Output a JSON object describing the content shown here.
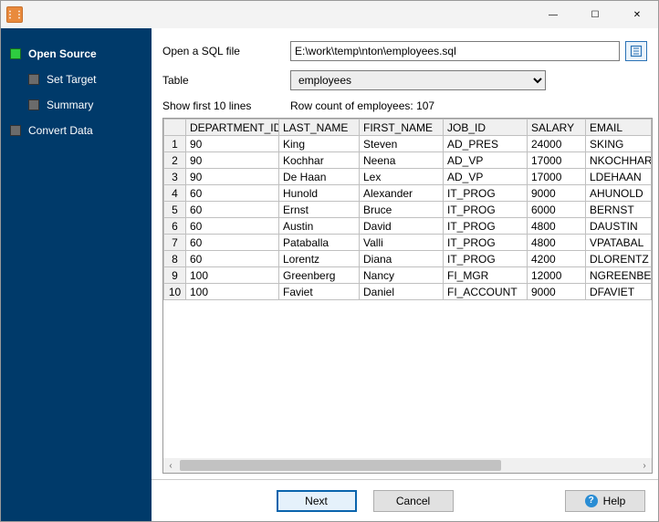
{
  "window": {
    "min_symbol": "—",
    "max_symbol": "☐",
    "close_symbol": "✕"
  },
  "sidebar": {
    "steps": [
      {
        "label": "Open Source",
        "current": true,
        "child": false
      },
      {
        "label": "Set Target",
        "current": false,
        "child": true
      },
      {
        "label": "Summary",
        "current": false,
        "child": true
      },
      {
        "label": "Convert Data",
        "current": false,
        "child": false
      }
    ]
  },
  "form": {
    "file_label": "Open a SQL file",
    "file_value": "E:\\work\\temp\\nton\\employees.sql",
    "table_label": "Table",
    "table_value": "employees",
    "show_first": "Show first 10 lines",
    "row_count": "Row count of employees: 107"
  },
  "table": {
    "headers": [
      "DEPARTMENT_ID",
      "LAST_NAME",
      "FIRST_NAME",
      "JOB_ID",
      "SALARY",
      "EMAIL"
    ],
    "rows": [
      [
        "90",
        "King",
        "Steven",
        "AD_PRES",
        "24000",
        "SKING"
      ],
      [
        "90",
        "Kochhar",
        "Neena",
        "AD_VP",
        "17000",
        "NKOCHHAR"
      ],
      [
        "90",
        "De Haan",
        "Lex",
        "AD_VP",
        "17000",
        "LDEHAAN"
      ],
      [
        "60",
        "Hunold",
        "Alexander",
        "IT_PROG",
        "9000",
        "AHUNOLD"
      ],
      [
        "60",
        "Ernst",
        "Bruce",
        "IT_PROG",
        "6000",
        "BERNST"
      ],
      [
        "60",
        "Austin",
        "David",
        "IT_PROG",
        "4800",
        "DAUSTIN"
      ],
      [
        "60",
        "Pataballa",
        "Valli",
        "IT_PROG",
        "4800",
        "VPATABAL"
      ],
      [
        "60",
        "Lorentz",
        "Diana",
        "IT_PROG",
        "4200",
        "DLORENTZ"
      ],
      [
        "100",
        "Greenberg",
        "Nancy",
        "FI_MGR",
        "12000",
        "NGREENBE"
      ],
      [
        "100",
        "Faviet",
        "Daniel",
        "FI_ACCOUNT",
        "9000",
        "DFAVIET"
      ]
    ]
  },
  "footer": {
    "next": "Next",
    "cancel": "Cancel",
    "help": "Help"
  }
}
